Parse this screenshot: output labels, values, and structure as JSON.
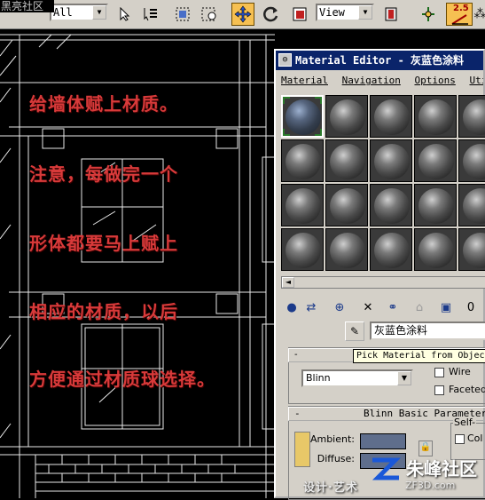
{
  "watermark_top_left": "黑亮社区",
  "toolbar": {
    "selection_filter": "All",
    "reference_coord": "View",
    "angle_snap_label": "2.5"
  },
  "notes": [
    "给墙体赋上材质。",
    "注意，每做完一个",
    "形体都要马上赋上",
    "相应的材质，以后",
    "方便通过材质球选择。"
  ],
  "material_editor": {
    "title": "Material Editor - 灰蓝色涂料",
    "menu": [
      "Material",
      "Navigation",
      "Options",
      "Utilities"
    ],
    "material_name": "灰蓝色涂料",
    "tooltip": "Pick Material from Object",
    "shader_rollout": {
      "collapse": "-",
      "shader": "Blinn",
      "options": [
        "Wire",
        "Faceted"
      ]
    },
    "basic_params": {
      "collapse": "-",
      "title": "Blinn Basic Parameters",
      "self_illum_label": "Self-",
      "self_illum_color_label": "Col",
      "ambient_label": "Ambient:",
      "diffuse_label": "Diffuse:",
      "swatch_color": "#5f6e8c"
    }
  },
  "bottom_watermark": {
    "brand": "朱峰社区",
    "tagline": "设计·艺术",
    "url": "ZF3D.com"
  },
  "colors": {
    "note_text": "#d83a3a",
    "titlebar": "#0a246a",
    "active_tool": "#f6c052"
  }
}
